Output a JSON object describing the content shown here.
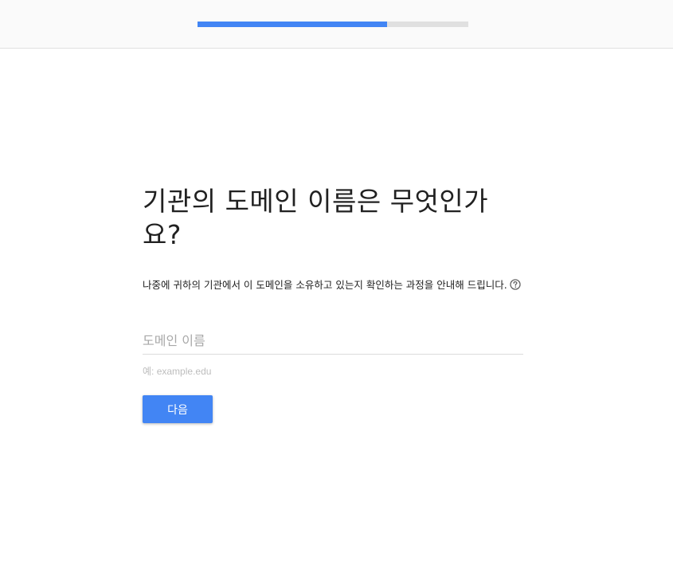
{
  "header": {
    "progress_percent": 70
  },
  "main": {
    "title": "기관의 도메인 이름은 무엇인가요?",
    "description": "나중에 귀하의 기관에서 이 도메인을 소유하고 있는지 확인하는 과정을 안내해 드립니다.",
    "domain_input": {
      "value": "",
      "placeholder": "도메인 이름"
    },
    "hint": "예: example.edu",
    "next_label": "다음"
  },
  "colors": {
    "accent": "#4285f4",
    "track": "#e0e0e0",
    "header_bg": "#fafafa"
  },
  "icons": {
    "help": "help-circle-icon"
  }
}
